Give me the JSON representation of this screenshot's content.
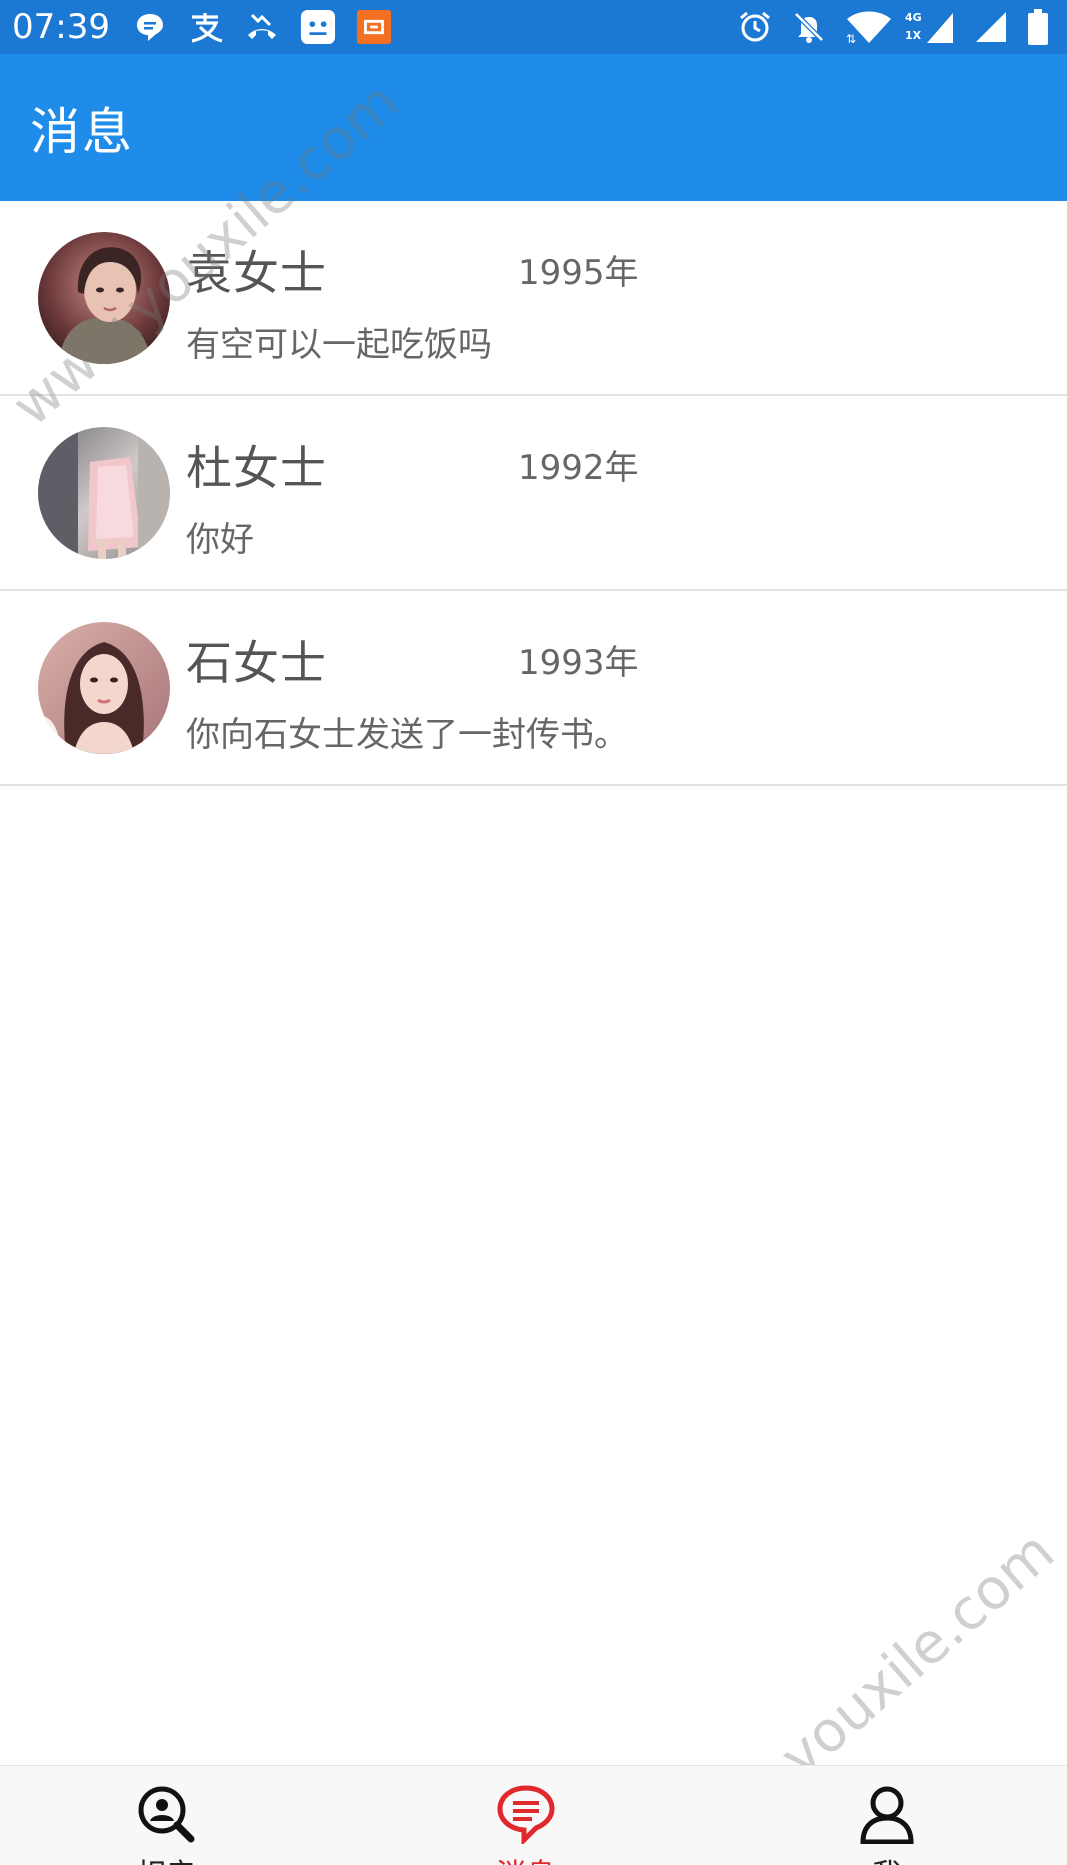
{
  "status_bar": {
    "time": "07:39",
    "left_icons": [
      "chat-bubble-icon",
      "alipay-icon",
      "missed-call-icon",
      "app-robot-icon",
      "app-orange-icon"
    ],
    "right_icons": [
      "alarm-icon",
      "bell-off-icon",
      "wifi-icon",
      "signal-4g-icon",
      "signal-icon",
      "battery-icon"
    ],
    "network_4g": "4G",
    "network_1x": "1X",
    "background": "#1c79d3"
  },
  "app_bar": {
    "title": "消息",
    "background": "#1e8ce8"
  },
  "conversations": [
    {
      "name": "袁女士",
      "year": "1995年",
      "message": "有空可以一起吃饭吗",
      "avatar": "avatar-photo-1"
    },
    {
      "name": "杜女士",
      "year": "1992年",
      "message": "你好",
      "avatar": "avatar-photo-2"
    },
    {
      "name": "石女士",
      "year": "1993年",
      "message": "你向石女士发送了一封传书。",
      "avatar": "avatar-photo-3"
    }
  ],
  "bottom_nav": {
    "items": [
      {
        "label": "相亲",
        "icon": "search-person-icon",
        "active": false
      },
      {
        "label": "消息",
        "icon": "message-icon",
        "active": true
      },
      {
        "label": "我",
        "icon": "user-icon",
        "active": false
      }
    ],
    "active_color": "#e0282d"
  },
  "watermark": {
    "text": "www.youxile.com"
  }
}
